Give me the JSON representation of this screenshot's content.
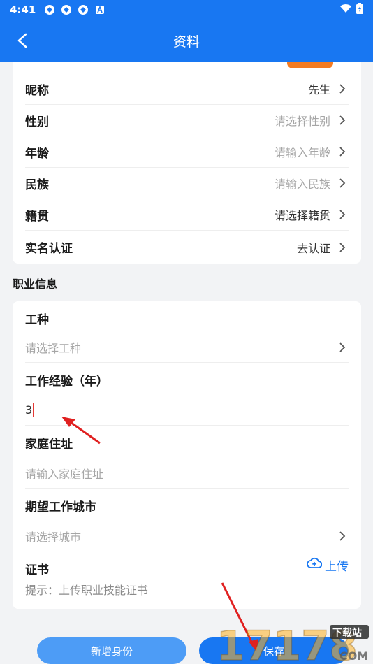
{
  "status_bar": {
    "time": "4:41",
    "icons": [
      "app-icon",
      "app-icon",
      "app-icon",
      "a-icon"
    ],
    "right_icons": [
      "wifi-icon",
      "battery-icon"
    ]
  },
  "header": {
    "title": "资料",
    "back_icon": "back-chevron-icon"
  },
  "personal_rows": [
    {
      "label": "昵称",
      "value": "先生",
      "placeholder": false
    },
    {
      "label": "性别",
      "value": "请选择性别",
      "placeholder": true
    },
    {
      "label": "年龄",
      "value": "请输入年龄",
      "placeholder": true
    },
    {
      "label": "民族",
      "value": "请输入民族",
      "placeholder": true
    },
    {
      "label": "籍贯",
      "value": "请选择籍贯",
      "placeholder": false
    },
    {
      "label": "实名认证",
      "value": "去认证",
      "placeholder": false
    }
  ],
  "career": {
    "section_title": "职业信息",
    "work_type": {
      "label": "工种",
      "placeholder": "请选择工种"
    },
    "experience": {
      "label": "工作经验（年）",
      "value": "3"
    },
    "address": {
      "label": "家庭住址",
      "placeholder": "请输入家庭住址"
    },
    "city": {
      "label": "期望工作城市",
      "placeholder": "请选择城市"
    },
    "certificate": {
      "label": "证书",
      "upload_label": "上传",
      "hint": "提示：上传职业技能证书"
    }
  },
  "buttons": {
    "add_identity": "新增身份",
    "save": "保存"
  },
  "watermark": {
    "text": "17178",
    "sub": "下载站",
    "domain": "COM"
  },
  "colors": {
    "primary": "#1877f2",
    "annotation_arrow": "#e02020"
  }
}
